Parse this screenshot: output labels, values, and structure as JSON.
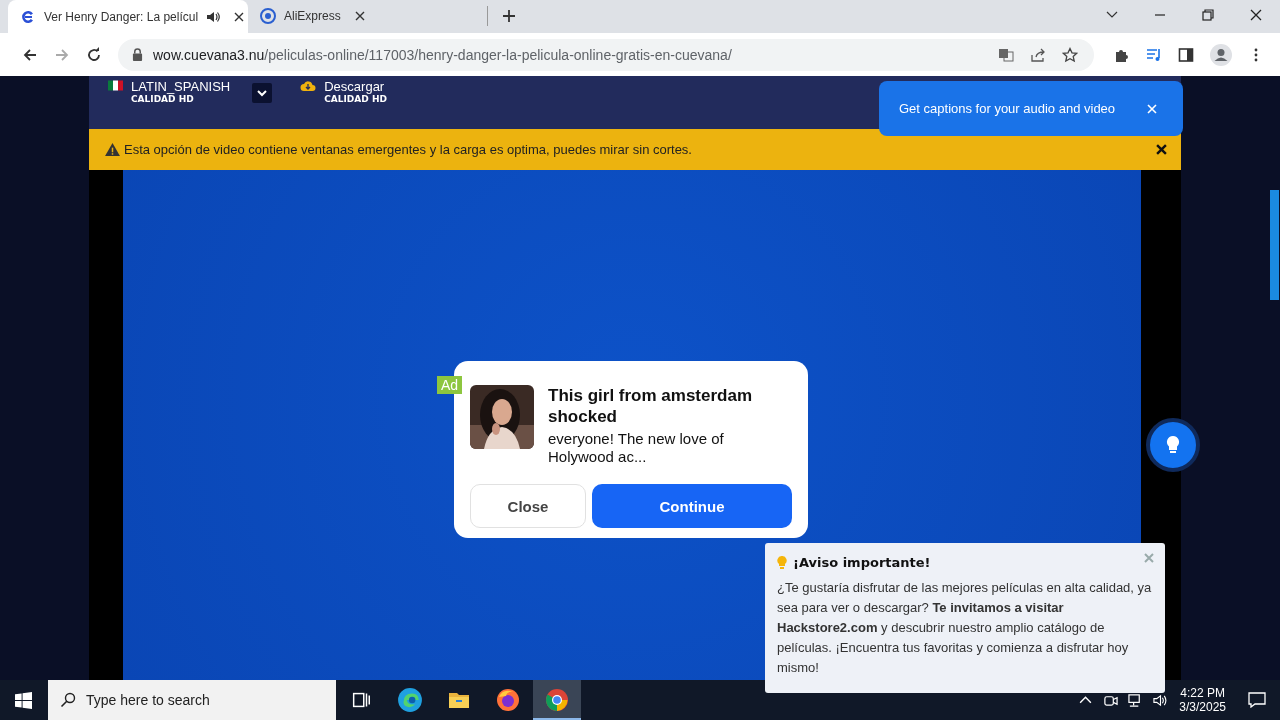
{
  "tabs": [
    {
      "title": "Ver Henry Danger: La películ",
      "selected": true,
      "audio": true,
      "kind": "cuevana"
    },
    {
      "title": "AliExpress",
      "selected": false,
      "audio": false,
      "kind": "aliexpress"
    }
  ],
  "address": {
    "host": "wow.cuevana3.nu",
    "path": "/peliculas-online/117003/henry-danger-la-pelicula-online-gratis-en-cuevana/"
  },
  "player_options": [
    {
      "kind": "language",
      "label": "LATIN_SPANISH",
      "quality": "CALIDAD HD"
    },
    {
      "kind": "download",
      "label": "Descargar",
      "quality": "CALIDAD HD"
    }
  ],
  "warning": "Esta opción de video contiene ventanas emergentes y la carga es optima, puedes mirar sin cortes.",
  "caption_bubble": "Get captions for your audio and video",
  "ad": {
    "badge": "Ad",
    "title": "This girl from amsterdam shocked",
    "body": "everyone! The new love of Holywood ac...",
    "buttons": [
      {
        "kind": "secondary",
        "label": "Close"
      },
      {
        "kind": "primary",
        "label": "Continue"
      }
    ]
  },
  "notice": {
    "title": "¡Aviso importante!",
    "body": "¿Te gustaría disfrutar de las mejores películas en alta calidad, ya sea para ver o descargar? **Te invitamos a visitar Hackstore2.com** y descubrir nuestro amplio catálogo de películas. ¡Encuentra tus favoritas y comienza a disfrutar hoy mismo!"
  },
  "taskbar": {
    "search_placeholder": "Type here to search",
    "apps": [
      {
        "kind": "taskview",
        "selected": false
      },
      {
        "kind": "edge",
        "selected": false
      },
      {
        "kind": "explorer",
        "selected": false
      },
      {
        "kind": "firefox",
        "selected": false
      },
      {
        "kind": "chrome",
        "selected": true
      }
    ],
    "time": "4:22 PM",
    "date": "3/3/2025"
  }
}
